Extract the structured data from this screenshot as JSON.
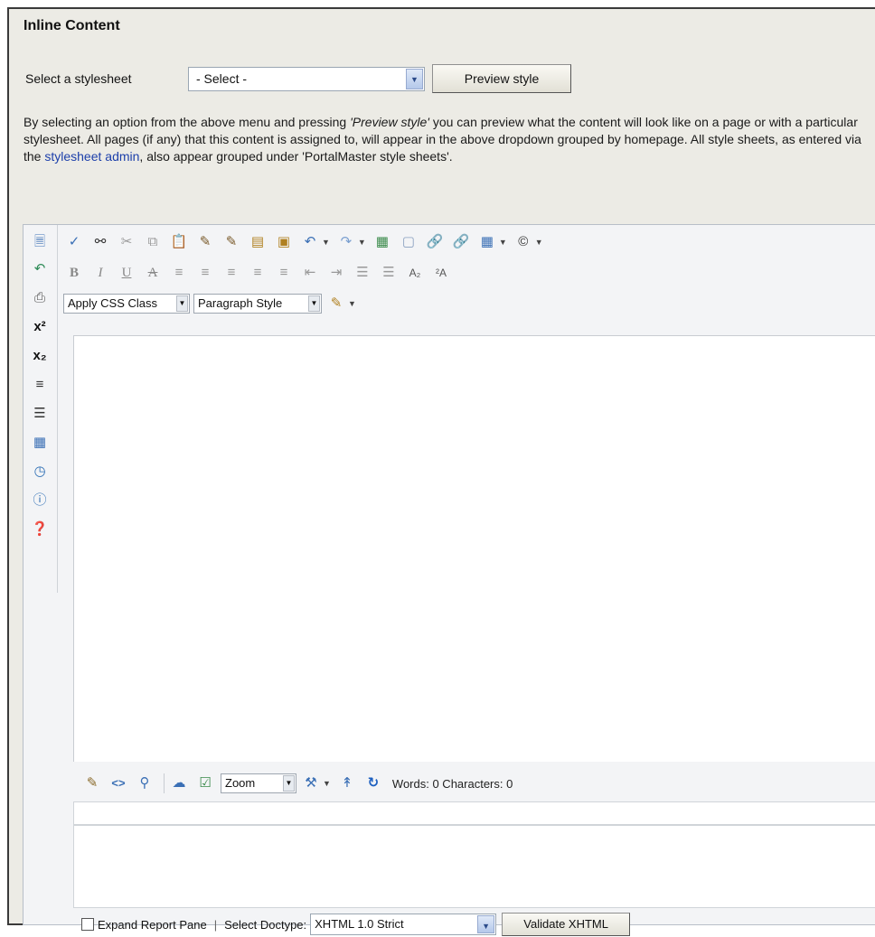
{
  "section_title": "Inline Content",
  "stylesheet": {
    "label": "Select a stylesheet",
    "selected": "- Select -",
    "preview_button": "Preview style"
  },
  "description": {
    "part1": "By selecting an option from the above menu and pressing ",
    "emph": "'Preview style'",
    "part2": " you can preview what the content will look like on a page or with a particular stylesheet. All pages (if any) that this content is assigned to, will appear in the above dropdown grouped by homepage. All style sheets, as entered via the ",
    "link": "stylesheet admin",
    "part3": ", also appear grouped under 'PortalMaster style sheets'."
  },
  "editor": {
    "left_toolbar_icons": [
      "page-icon",
      "page-back-icon",
      "print-icon",
      "superscript-icon",
      "subscript-icon",
      "paragraph-rtl-icon",
      "list-format-icon",
      "template-icon",
      "clock-icon",
      "info-icon",
      "help-icon"
    ],
    "css_class_combo": "Apply CSS Class",
    "paragraph_combo": "Paragraph Style",
    "zoom_combo": "Zoom",
    "word_count": "Words: 0 Characters: 0"
  },
  "status": {
    "expand_label": "Expand Report Pane",
    "doctype_label": "Select Doctype:",
    "doctype_value": "XHTML 1.0 Strict",
    "validate_button": "Validate XHTML"
  },
  "colors": {
    "panel_bg": "#ecebe5",
    "link": "#1c3faa"
  }
}
